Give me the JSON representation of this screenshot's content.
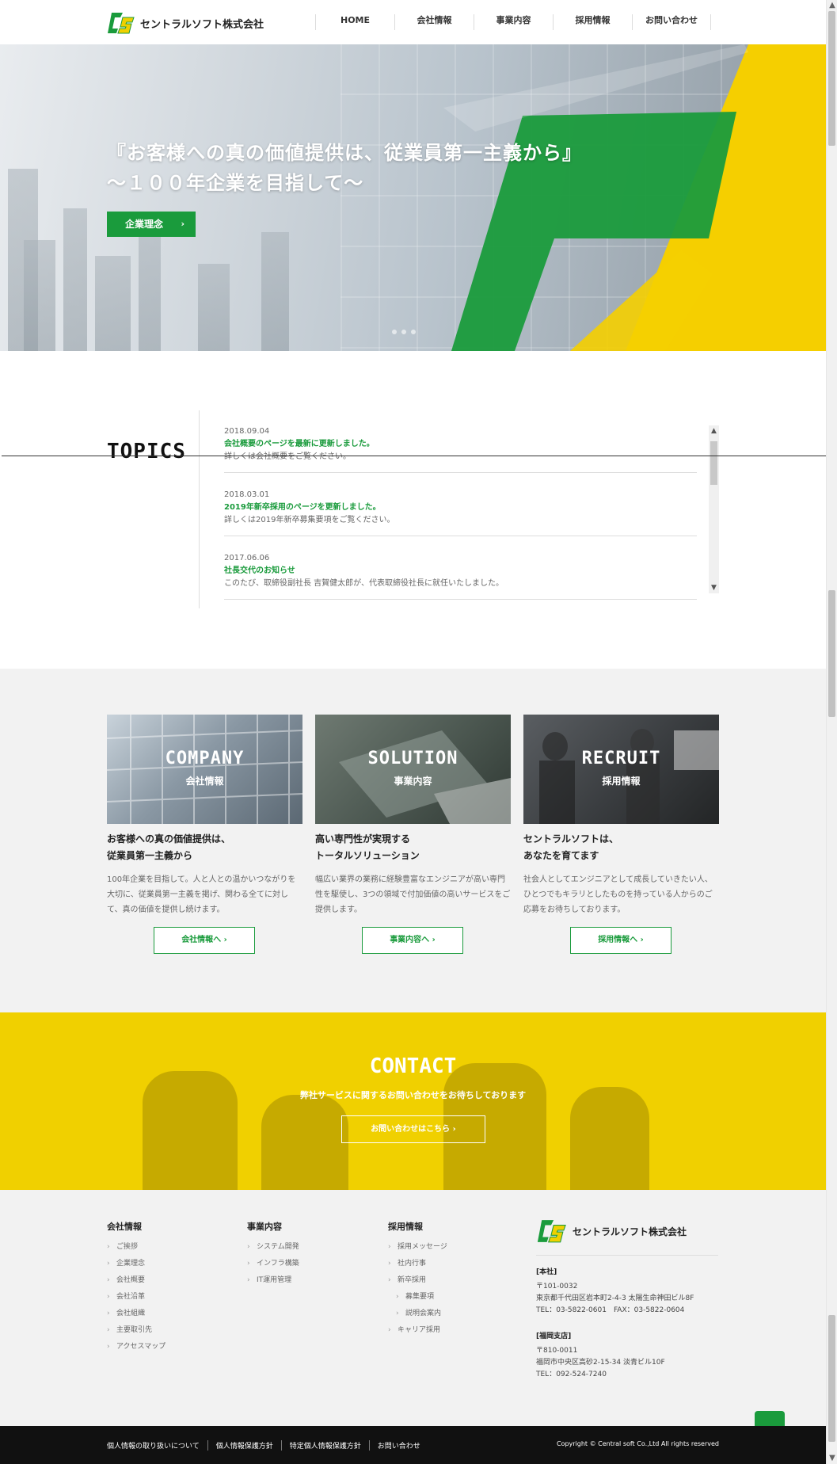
{
  "header": {
    "company_name": "セントラルソフト株式会社",
    "nav": [
      "HOME",
      "会社情報",
      "事業内容",
      "採用情報",
      "お問い合わせ"
    ]
  },
  "hero": {
    "catch_line1": "『お客様への真の価値提供は、従業員第一主義から』",
    "catch_line2": "～１００年企業を目指して～",
    "button_label": "企業理念"
  },
  "topics": {
    "title": "TOPICS",
    "items": [
      {
        "date": "2018.09.04",
        "title": "会社概要のページを最新に更新しました。",
        "body": "詳しくは会社概要をご覧ください。"
      },
      {
        "date": "2018.03.01",
        "title": "2019年新卒採用のページを更新しました。",
        "body": "詳しくは2019年新卒募集要項をご覧ください。"
      },
      {
        "date": "2017.06.06",
        "title": "社長交代のお知らせ",
        "body": "このたび、取締役副社長 吉賀健太郎が、代表取締役社長に就任いたしました。"
      }
    ]
  },
  "cards": [
    {
      "en": "COMPANY",
      "ja": "会社情報",
      "lead1": "お客様への真の価値提供は、",
      "lead2": "従業員第一主義から",
      "desc": "100年企業を目指して。人と人との温かいつながりを大切に、従業員第一主義を掲げ、関わる全てに対して、真の価値を提供し続けます。",
      "button": "会社情報へ"
    },
    {
      "en": "SOLUTION",
      "ja": "事業内容",
      "lead1": "高い専門性が実現する",
      "lead2": "トータルソリューション",
      "desc": "幅広い業界の業務に経験豊富なエンジニアが高い専門性を駆使し、3つの領域で付加価値の高いサービスをご提供します。",
      "button": "事業内容へ"
    },
    {
      "en": "RECRUIT",
      "ja": "採用情報",
      "lead1": "セントラルソフトは、",
      "lead2": "あなたを育てます",
      "desc": "社会人としてエンジニアとして成長していきたい人、ひとつでもキラリとしたものを持っている人からのご応募をお待ちしております。",
      "button": "採用情報へ"
    }
  ],
  "contact": {
    "title": "CONTACT",
    "subtitle": "弊社サービスに関するお問い合わせをお待ちしております",
    "button": "お問い合わせはこちら"
  },
  "footer": {
    "columns": [
      {
        "heading": "会社情報",
        "items": [
          {
            "label": "ご挨拶"
          },
          {
            "label": "企業理念"
          },
          {
            "label": "会社概要"
          },
          {
            "label": "会社沿革"
          },
          {
            "label": "会社組織"
          },
          {
            "label": "主要取引先"
          },
          {
            "label": "アクセスマップ"
          }
        ]
      },
      {
        "heading": "事業内容",
        "items": [
          {
            "label": "システム開発"
          },
          {
            "label": "インフラ構築"
          },
          {
            "label": "IT運用管理"
          }
        ]
      },
      {
        "heading": "採用情報",
        "items": [
          {
            "label": "採用メッセージ"
          },
          {
            "label": "社内行事"
          },
          {
            "label": "新卒採用"
          },
          {
            "label": "募集要項",
            "sub": true
          },
          {
            "label": "説明会案内",
            "sub": true
          },
          {
            "label": "キャリア採用"
          }
        ]
      }
    ],
    "company_name": "セントラルソフト株式会社",
    "offices": [
      {
        "heading": "[本社]",
        "lines": [
          "〒101-0032",
          "東京都千代田区岩本町2-4-3 太陽生命神田ビル8F",
          "TEL：03-5822-0601　FAX：03-5822-0604"
        ]
      },
      {
        "heading": "[福岡支店]",
        "lines": [
          "〒810-0011",
          "福岡市中央区高砂2-15-34 淡青ビル10F",
          "TEL：092-524-7240"
        ]
      }
    ]
  },
  "bottombar": {
    "links": [
      "個人情報の取り扱いについて",
      "個人情報保護方針",
      "特定個人情報保護方針",
      "お問い合わせ"
    ],
    "copyright": "Copyright © Central soft Co.,Ltd All rights reserved"
  },
  "colors": {
    "brand_green": "#1a9b3c",
    "brand_yellow": "#f0d000"
  }
}
